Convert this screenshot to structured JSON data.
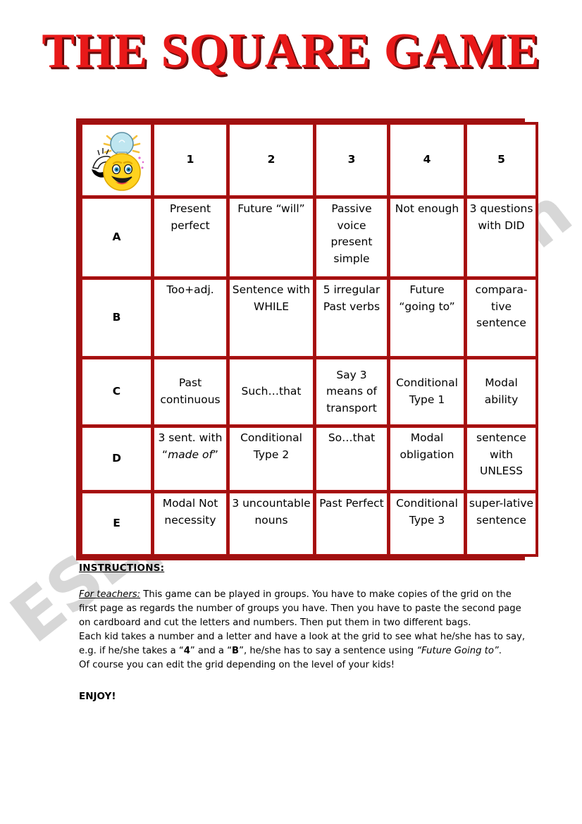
{
  "title": "THE SQUARE GAME",
  "colors": {
    "title_red": "#e81919",
    "title_shadow": "#6e0c0c",
    "grid_border_red": "#a01010",
    "number_blue": "#1a1ad0",
    "letter_green": "#1a7a1a",
    "watermark_gray": "#c9c9c9"
  },
  "watermark": "ESLprintables.com",
  "grid": {
    "corner_icon": "lightbulb-smiley-icon",
    "column_headers": [
      "1",
      "2",
      "3",
      "4",
      "5"
    ],
    "rows": [
      {
        "letter": "A",
        "cells": [
          "Present perfect",
          "Future “will”",
          "Passive voice present simple",
          "Not enough",
          "3 questions with DID"
        ]
      },
      {
        "letter": "B",
        "cells": [
          "Too+adj.",
          "Sentence with WHILE",
          "5 irregular Past verbs",
          "Future “going to”",
          "compara-tive sentence"
        ]
      },
      {
        "letter": "C",
        "cells": [
          "Past continuous",
          "Such…that",
          "Say 3 means of transport",
          "Conditional Type 1",
          "Modal ability"
        ]
      },
      {
        "letter": "D",
        "cells": [
          "3 sent. with “made of”",
          "Conditional Type 2",
          "So…that",
          "Modal obligation",
          "sentence with UNLESS"
        ]
      },
      {
        "letter": "E",
        "cells": [
          "Modal Not necessity",
          "3 uncountable nouns",
          "Past Perfect",
          "Conditional Type 3",
          "super-lative sentence"
        ]
      }
    ]
  },
  "instructions": {
    "heading": "INSTRUCTIONS:",
    "for_teachers_label": "For teachers:",
    "paragraph_1": " This game can be played in groups. You have to make copies of the grid on the first page as regards the number of groups you have. Then you have to paste the second page on cardboard and cut the letters and numbers. Then put them in two different bags.",
    "paragraph_2_part1": "Each kid takes a number and a letter and have a look at the grid to see what he/she has to say, e.g. if he/she takes a “",
    "example_number": "4",
    "paragraph_2_part2": "” and a “",
    "example_letter": "B",
    "paragraph_2_part3": "”, he/she has to say a sentence using ",
    "example_structure": "“Future Going to”",
    "paragraph_2_end": ".",
    "paragraph_3": "Of course you can edit the grid depending on the level of your kids!",
    "enjoy": "ENJOY!"
  }
}
